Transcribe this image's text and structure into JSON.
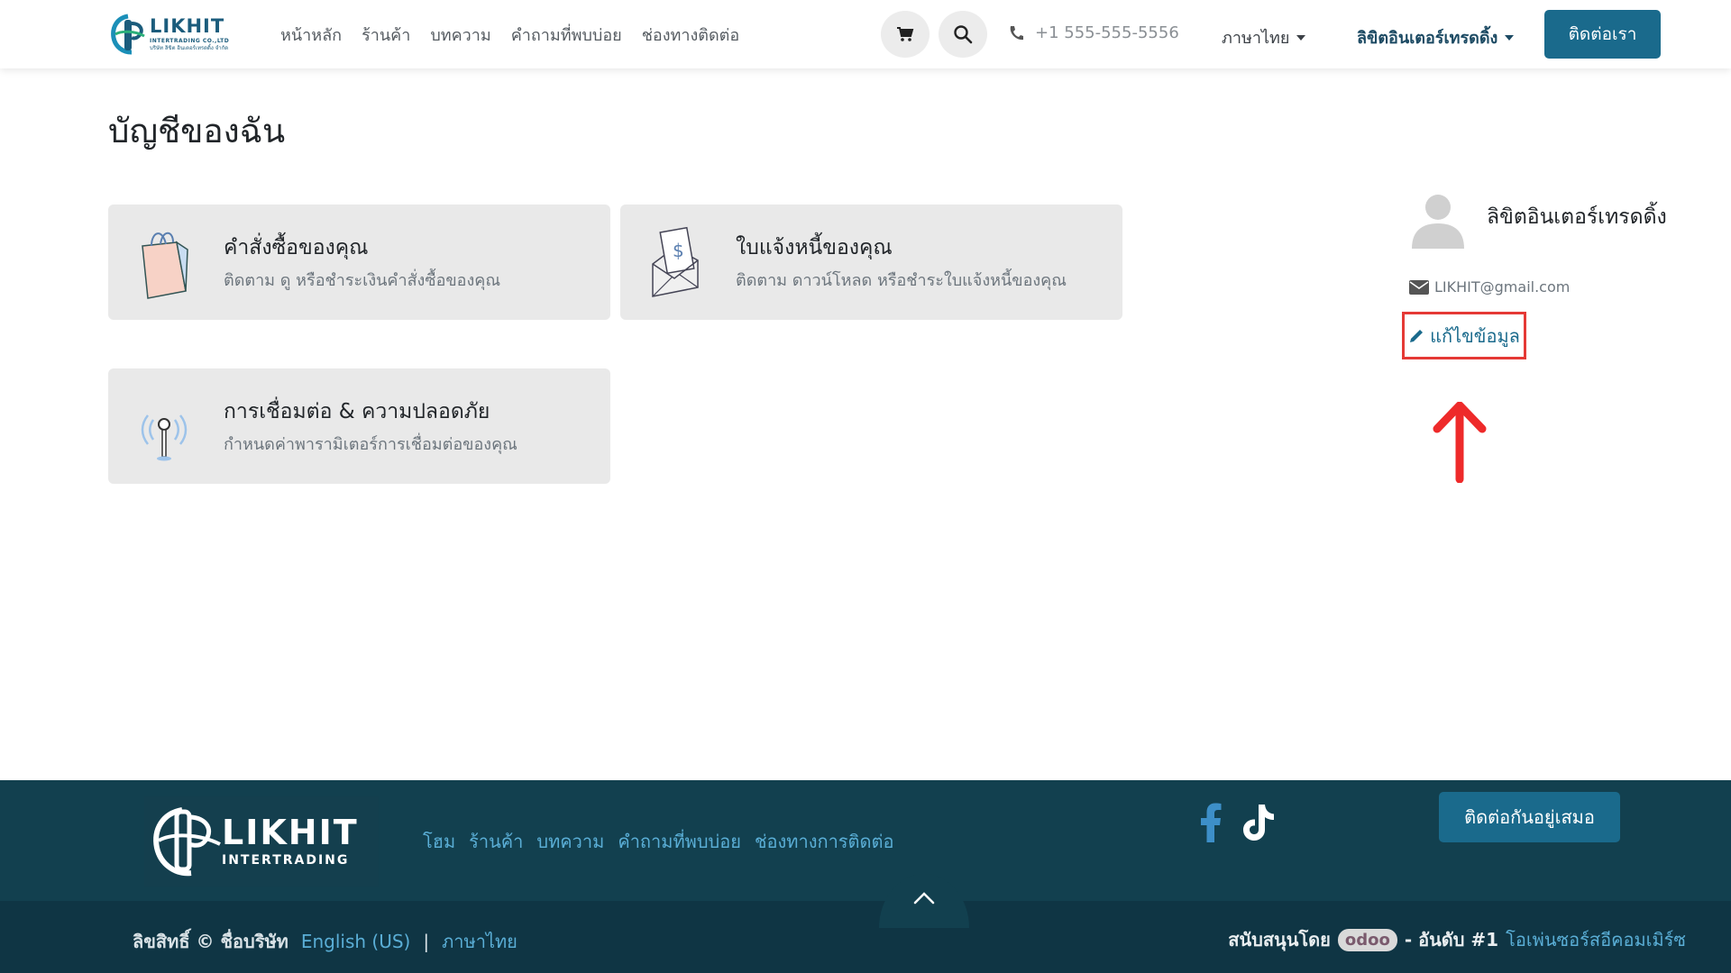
{
  "header": {
    "logo": {
      "brand": "LIKHIT",
      "line1": "INTERTRADING CO.,LTD",
      "line2": "บริษัท ลิขิต อินเตอร์เทรดดิ้ง จำกัด"
    },
    "nav": [
      "หน้าหลัก",
      "ร้านค้า",
      "บทความ",
      "คำถามที่พบบ่อย",
      "ช่องทางติดต่อ"
    ],
    "phone": "+1 555-555-5556",
    "language": "ภาษาไทย",
    "user": "ลิขิตอินเตอร์เทรดดิ้ง",
    "contact_button": "ติดต่อเรา"
  },
  "main": {
    "title": "บัญชีของฉัน",
    "cards": [
      {
        "title": "คำสั่งซื้อของคุณ",
        "desc": "ติดตาม ดู หรือชำระเงินคำสั่งซื้อของคุณ",
        "icon": "shopping-bag-icon"
      },
      {
        "title": "ใบแจ้งหนี้ของคุณ",
        "desc": "ติดตาม ดาวน์โหลด หรือชำระใบแจ้งหนี้ของคุณ",
        "icon": "invoice-envelope-icon"
      },
      {
        "title": "การเชื่อมต่อ & ความปลอดภัย",
        "desc": "กำหนดค่าพารามิเตอร์การเชื่อมต่อของคุณ",
        "icon": "antenna-icon"
      }
    ]
  },
  "sidebar": {
    "name": "ลิขิตอินเตอร์เทรดดิ้ง",
    "email": "LIKHIT@gmail.com",
    "edit_label": "แก้ไขข้อมูล"
  },
  "footer": {
    "logo": {
      "brand": "LIKHIT",
      "sub": "INTERTRADING"
    },
    "nav": [
      "โฮม",
      "ร้านค้า",
      "บทความ",
      "คำถามที่พบบ่อย",
      "ช่องทางการติดต่อ"
    ],
    "contact_button": "ติดต่อกันอยู่เสมอ",
    "copyright": "ลิขสิทธิ์ © ชื่อบริษัท",
    "lang_en": "English (US)",
    "separator": "|",
    "lang_th": "ภาษาไทย",
    "powered_prefix": "สนับสนุนโดย",
    "powered_brand": "odoo",
    "powered_mid": "- อันดับ #1",
    "powered_link": "โอเพ่นซอร์สอีคอมเมิร์ซ"
  },
  "colors": {
    "primary": "#1a6a8c",
    "footer": "#12404f",
    "highlight": "#e53935"
  }
}
